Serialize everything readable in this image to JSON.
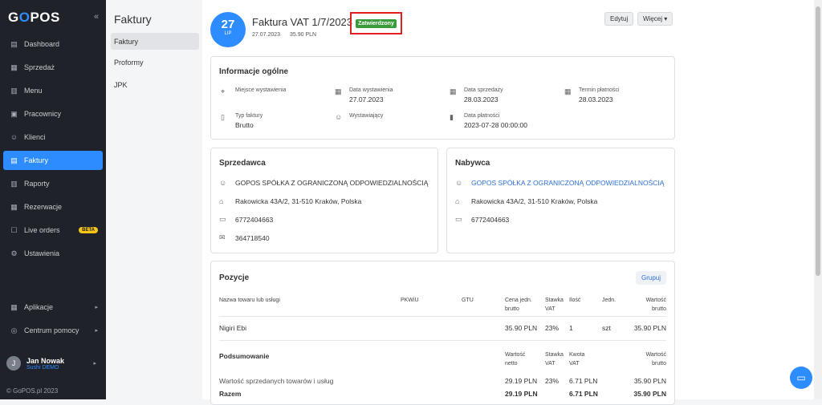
{
  "sidebar": {
    "logo_prefix": "G",
    "logo_o": "O",
    "logo_suffix": "POS",
    "collapse": "«",
    "items": [
      {
        "label": "Dashboard",
        "icon": "dashboard-icon",
        "glyph": "▤"
      },
      {
        "label": "Sprzedaż",
        "icon": "sales-icon",
        "glyph": "▦"
      },
      {
        "label": "Menu",
        "icon": "menu-icon",
        "glyph": "▥"
      },
      {
        "label": "Pracownicy",
        "icon": "employees-icon",
        "glyph": "▣"
      },
      {
        "label": "Klienci",
        "icon": "clients-icon",
        "glyph": "☺"
      },
      {
        "label": "Faktury",
        "icon": "invoices-icon",
        "glyph": "▤"
      },
      {
        "label": "Raporty",
        "icon": "reports-icon",
        "glyph": "▥"
      },
      {
        "label": "Rezerwacje",
        "icon": "reservations-icon",
        "glyph": "▦"
      },
      {
        "label": "Live orders",
        "icon": "live-orders-icon",
        "glyph": "☐",
        "badge": "BETA"
      },
      {
        "label": "Ustawienia",
        "icon": "settings-icon",
        "glyph": "⚙"
      }
    ],
    "bottom_items": [
      {
        "label": "Aplikacje",
        "icon": "apps-icon",
        "glyph": "▦",
        "arrow": "▸"
      },
      {
        "label": "Centrum pomocy",
        "icon": "help-icon",
        "glyph": "◎",
        "arrow": "▸"
      }
    ],
    "user": {
      "initial": "J",
      "name": "Jan Nowak",
      "sub": "Sushi DEMO",
      "arrow": "▸"
    },
    "copyright": "© GoPOS.pl 2023"
  },
  "submenu": {
    "title": "Faktury",
    "items": [
      "Faktury",
      "Proformy",
      "JPK"
    ]
  },
  "header": {
    "day": "27",
    "month": "LIP",
    "title": "Faktura VAT 1/7/2023",
    "status": "Zatwierdzony",
    "date": "27.07.2023",
    "amount": "35.90 PLN",
    "edit_label": "Edytuj",
    "more_label": "Więcej ▾"
  },
  "general": {
    "title": "Informacje ogólne",
    "place_label": "Miejsce wystawienia",
    "issue_date_label": "Data wystawienia",
    "issue_date": "27.07.2023",
    "sale_date_label": "Data sprzedaży",
    "sale_date": "28.03.2023",
    "due_label": "Termin płatności",
    "due": "28.03.2023",
    "type_label": "Typ faktury",
    "type": "Brutto",
    "issuer_label": "Wystawiający",
    "pay_date_label": "Data płatności",
    "pay_date": "2023-07-28 00:00:00"
  },
  "seller": {
    "title": "Sprzedawca",
    "name": "GOPOS SPÓŁKA Z OGRANICZONĄ ODPOWIEDZIALNOŚCIĄ",
    "address": "Rakowicka 43A/2, 31-510 Kraków, Polska",
    "nip": "6772404663",
    "regon": "364718540"
  },
  "buyer": {
    "title": "Nabywca",
    "name": "GOPOS SPÓŁKA Z OGRANICZONĄ ODPOWIEDZIALNOŚCIĄ",
    "address": "Rakowicka 43A/2, 31-510 Kraków, Polska",
    "nip": "6772404663"
  },
  "positions": {
    "title": "Pozycje",
    "group_label": "Grupuj",
    "headers": {
      "name": "Nazwa towaru lub usługi",
      "pkwiu": "PKWiU",
      "gtu": "GTU",
      "unit_price_1": "Cena jedn.",
      "unit_price_2": "brutto",
      "vat_rate_1": "Stawka",
      "vat_rate_2": "VAT",
      "qty": "Ilość",
      "unit": "Jedn.",
      "gross_1": "Wartość",
      "gross_2": "brutto"
    },
    "item": {
      "name": "Nigiri Ebi",
      "unit_price": "35.90 PLN",
      "vat": "23%",
      "qty": "1",
      "unit": "szt",
      "gross": "35.90 PLN"
    },
    "summary": {
      "title": "Podsumowanie",
      "net_1": "Wartość",
      "net_2": "netto",
      "vat_rate_1": "Stawka",
      "vat_rate_2": "VAT",
      "vat_amount_1": "Kwota",
      "vat_amount_2": "VAT",
      "gross_1": "Wartość",
      "gross_2": "brutto",
      "row_label": "Wartość sprzedanych towarów i usług",
      "row_net": "29.19 PLN",
      "row_vat": "23%",
      "row_vat_amount": "6.71 PLN",
      "row_gross": "35.90 PLN",
      "total_label": "Razem",
      "total_net": "29.19 PLN",
      "total_vat_amount": "6.71 PLN",
      "total_gross": "35.90 PLN"
    }
  }
}
